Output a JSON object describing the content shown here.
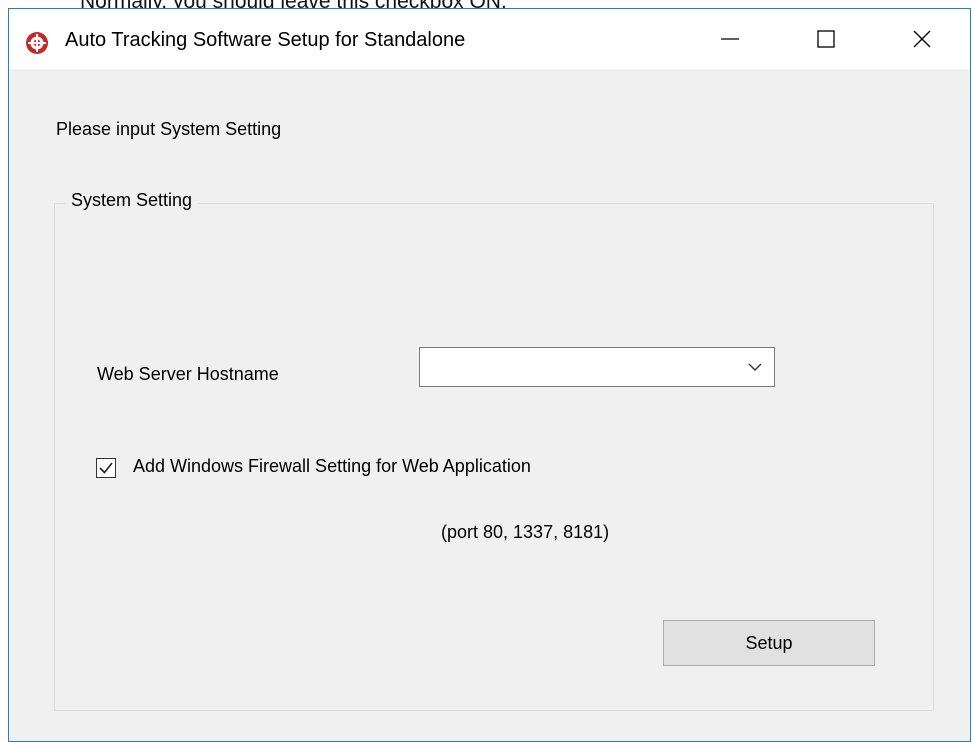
{
  "background": {
    "caption": "Normally, you should leave this checkbox ON."
  },
  "window": {
    "title": "Auto Tracking Software Setup for Standalone",
    "icon": "app-badge-icon",
    "controls": {
      "minimize": "minimize-icon",
      "maximize": "maximize-icon",
      "close": "close-icon"
    }
  },
  "form": {
    "prompt": "Please input System Setting",
    "group_title": "System Setting",
    "hostname_label": "Web Server Hostname",
    "hostname_value": "",
    "firewall_checked": true,
    "firewall_label": "Add Windows Firewall Setting for Web Application",
    "port_note": "(port 80, 1337, 8181)",
    "setup_label": "Setup"
  },
  "colors": {
    "window_border": "#1e7fd6",
    "icon_red": "#c62828",
    "client_bg": "#f0f0f0"
  }
}
